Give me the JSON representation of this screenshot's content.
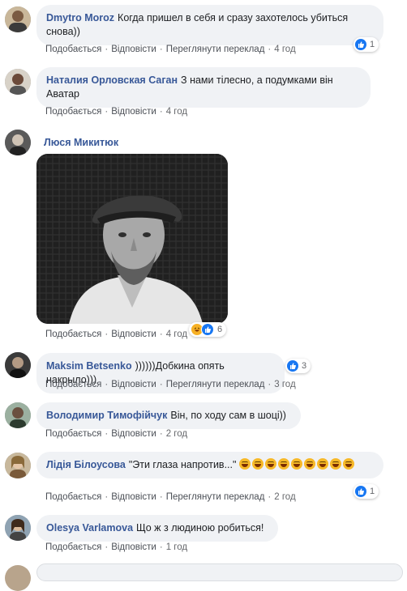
{
  "actions": {
    "like": "Подобається",
    "reply": "Відповісти",
    "translate": "Переглянути переклад",
    "sep": "·"
  },
  "comments": [
    {
      "author": "Dmytro Moroz",
      "text": "Когда пришел в себя и сразу захотелось убиться снова))",
      "time": "4 год",
      "reactions": "1"
    },
    {
      "author": "Наталия Орловская Саган",
      "text": "З нами тілесно, а подумками він Аватар",
      "time": "4 год"
    },
    {
      "author": "Люся Микитюк",
      "text": "",
      "time": "4 год",
      "reactions": "6"
    },
    {
      "author": "Maksim Betsenko",
      "text": "))))))Добкина опять накрыло)))",
      "time": "3 год",
      "reactions": "3"
    },
    {
      "author": "Володимир Тимофійчук",
      "text": "Він, по ходу сам в шоці))",
      "time": "2 год"
    },
    {
      "author": "Лідія Білоусова",
      "text": "\"Эти глаза напротив...\"",
      "time": "2 год",
      "reactions": "1"
    },
    {
      "author": "Olesya Varlamova",
      "text": "Що ж з людиною робиться!",
      "time": "1 год"
    }
  ],
  "icons": {
    "like": "like-icon",
    "haha": "haha-icon",
    "smile": "grinning-emoji-icon"
  },
  "colors": {
    "author": "#385898",
    "bubble": "#f0f2f5",
    "like": "#1877f2"
  }
}
